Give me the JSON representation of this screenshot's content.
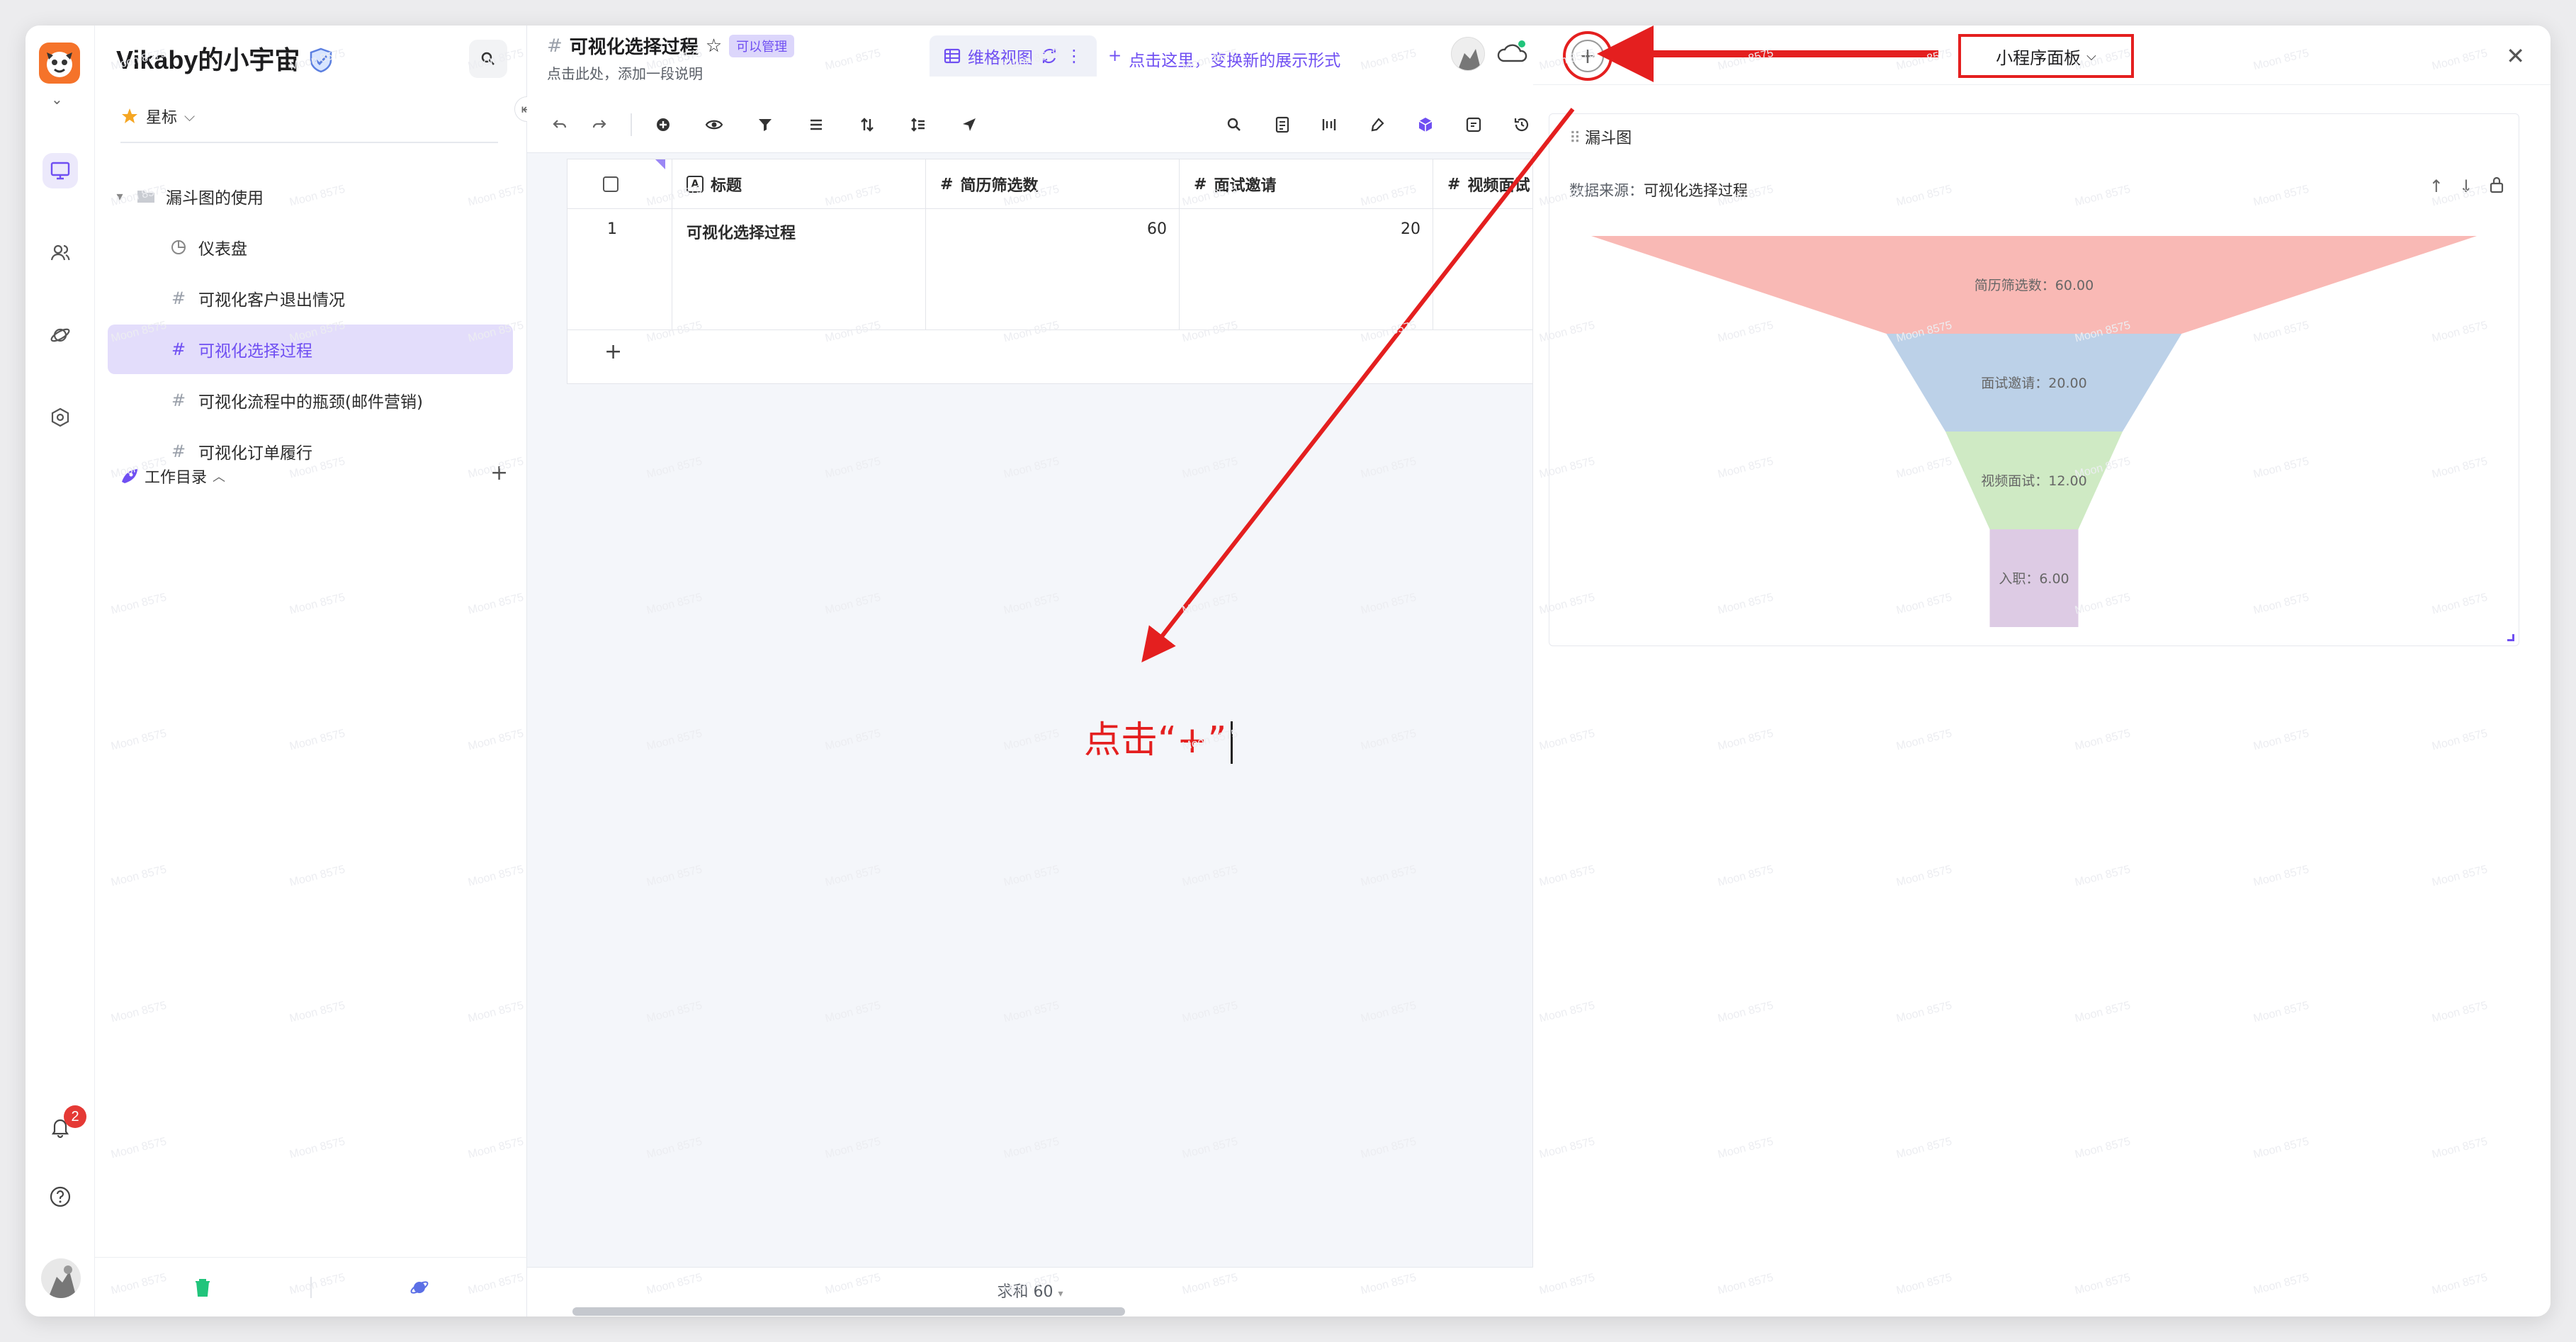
{
  "space": {
    "name": "Vikaby的小宇宙",
    "star_label": "星标"
  },
  "sidebar": {
    "folder": "漏斗图的使用",
    "items": [
      {
        "label": "仪表盘",
        "icon": "dashboard-icon"
      },
      {
        "label": "可视化客户退出情况",
        "icon": "datasheet-icon"
      },
      {
        "label": "可视化选择过程",
        "icon": "datasheet-icon",
        "selected": true
      },
      {
        "label": "可视化流程中的瓶颈(邮件营销)",
        "icon": "datasheet-icon"
      },
      {
        "label": "可视化订单履行",
        "icon": "datasheet-icon"
      }
    ],
    "workdir_label": "工作目录"
  },
  "rail": {
    "notification_count": "2"
  },
  "sheet": {
    "title": "可视化选择过程",
    "permission": "可以管理",
    "description": "点击此处，添加一段说明",
    "view_tab": "维格视图",
    "add_view_hint": "点击这里，变换新的展示形式",
    "columns": [
      "标题",
      "简历筛选数",
      "面试邀请",
      "视频面试"
    ],
    "rows": [
      {
        "index": "1",
        "title": "可视化选择过程",
        "resume": "60",
        "invite": "20"
      }
    ],
    "sum_label": "求和 60"
  },
  "widget_panel": {
    "panel_name": "小程序面板",
    "widget_title": "漏斗图",
    "source_label": "数据来源：",
    "source_value": "可视化选择过程"
  },
  "chart_data": {
    "type": "funnel",
    "stages": [
      {
        "name": "简历筛选数",
        "value": 60.0,
        "label": "简历筛选数：60.00",
        "color": "#f9b9b5"
      },
      {
        "name": "面试邀请",
        "value": 20.0,
        "label": "面试邀请：20.00",
        "color": "#bcd1e8"
      },
      {
        "name": "视频面试",
        "value": 12.0,
        "label": "视频面试：12.00",
        "color": "#cfeac4"
      },
      {
        "name": "入职",
        "value": 6.0,
        "label": "入职：6.00",
        "color": "#ddcbe4"
      }
    ]
  },
  "annotation": {
    "text": "点击“+”",
    "color": "#e41f1f"
  },
  "watermark": "Moon 8575"
}
